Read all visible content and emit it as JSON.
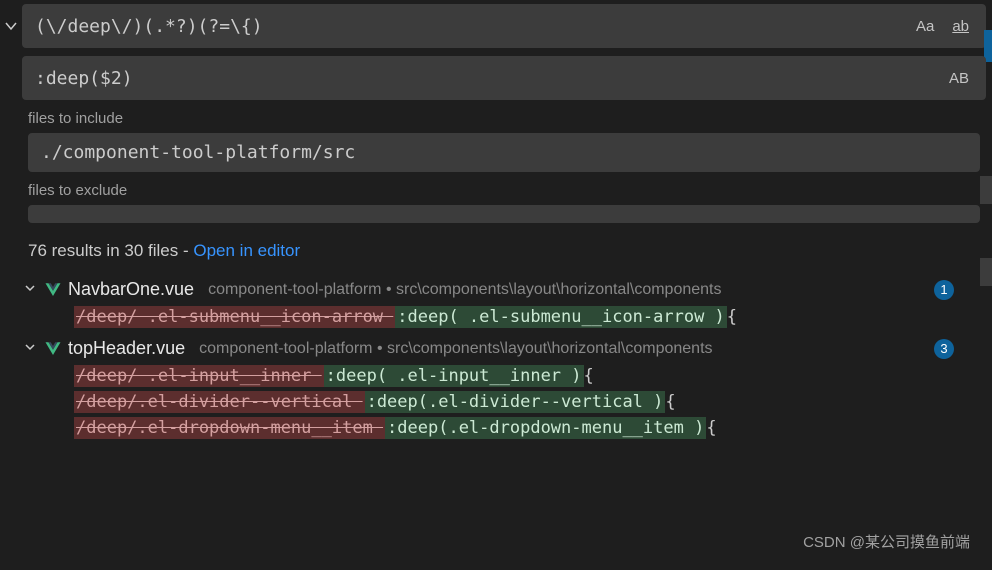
{
  "search": {
    "pattern": "(\\/deep\\/)(.*?)(?=\\{)",
    "replace": ":deep($2)",
    "caseSensitive": "Aa",
    "wholeWord": "ab",
    "preserveCase": "AB"
  },
  "labels": {
    "filesToInclude": "files to include",
    "filesToExclude": "files to exclude"
  },
  "include": {
    "value": "./component-tool-platform/src"
  },
  "exclude": {
    "value": ""
  },
  "summary": {
    "text": "76 results in 30 files - ",
    "openInEditor": "Open in editor"
  },
  "files": [
    {
      "name": "NavbarOne.vue",
      "path": "component-tool-platform • src\\components\\layout\\horizontal\\components",
      "count": "1",
      "matches": [
        {
          "removed": "/deep/ .el-submenu__icon-arrow ",
          "added": ":deep( .el-submenu__icon-arrow )",
          "tail": "{"
        }
      ]
    },
    {
      "name": "topHeader.vue",
      "path": "component-tool-platform • src\\components\\layout\\horizontal\\components",
      "count": "3",
      "matches": [
        {
          "removed": "/deep/ .el-input__inner ",
          "added": ":deep( .el-input__inner )",
          "tail": "{"
        },
        {
          "removed": "/deep/.el-divider--vertical ",
          "added": ":deep(.el-divider--vertical )",
          "tail": "{"
        },
        {
          "removed": "/deep/.el-dropdown-menu__item ",
          "added": ":deep(.el-dropdown-menu__item )",
          "tail": "{"
        }
      ]
    }
  ],
  "watermark": "CSDN @某公司摸鱼前端"
}
